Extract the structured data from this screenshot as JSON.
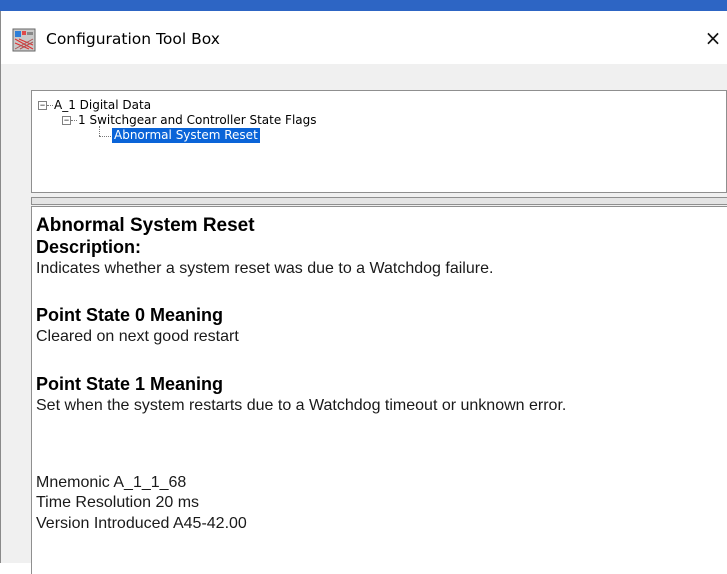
{
  "window": {
    "title": "Configuration Tool Box",
    "close_glyph": "×"
  },
  "tree": {
    "root": "A_1 Digital Data",
    "child": "1 Switchgear and Controller State Flags",
    "leaf": "Abnormal System Reset",
    "toggle_expanded_glyph": "−"
  },
  "details": {
    "heading": "Abnormal System Reset",
    "description_label": "Description:",
    "description_text": "Indicates whether a system reset was due to a Watchdog failure.",
    "state0_label": "Point State 0 Meaning",
    "state0_text": "Cleared on next good restart",
    "state1_label": "Point State 1 Meaning",
    "state1_text": "Set when the system restarts due to a Watchdog timeout or unknown error.",
    "mnemonic": "Mnemonic A_1_1_68",
    "time_resolution": "Time Resolution 20 ms",
    "version": "Version Introduced A45-42.00"
  },
  "colors": {
    "selection": "#0a64d8",
    "top_strip": "#2d65c4"
  }
}
